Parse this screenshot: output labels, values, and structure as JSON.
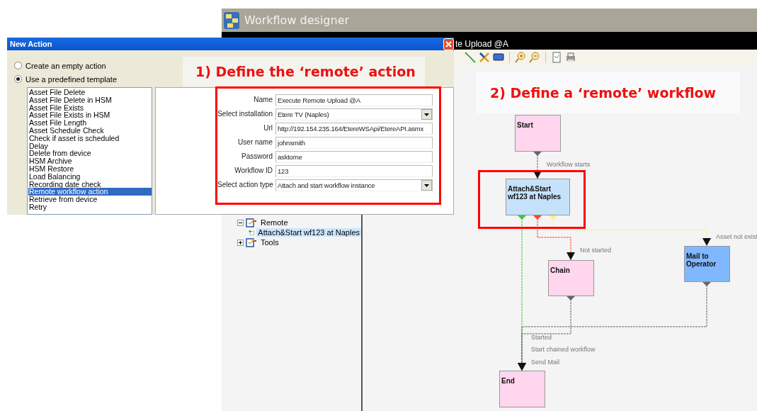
{
  "designer": {
    "title": "Workflow designer",
    "document_title": "te Upload @A",
    "tree": [
      {
        "label": "Remote",
        "expanded": true,
        "children": [
          {
            "label": "Attach&Start wf123 at Naples",
            "selected": true
          }
        ]
      },
      {
        "label": "Tools",
        "expanded": false
      }
    ],
    "diagram": {
      "nodes": [
        {
          "label": "Start",
          "color": "#ffd6ee"
        },
        {
          "label": "Attach&Start wf123 at Naples",
          "color": "#c6e2fb"
        },
        {
          "label": "Chain",
          "color": "#ffd6ee"
        },
        {
          "label": "Mail to Operator",
          "color": "#80b8ff"
        },
        {
          "label": "End",
          "color": "#ffd6ee"
        }
      ],
      "edges": [
        {
          "label": "Workflow starts",
          "color": "#666666"
        },
        {
          "label": "Started",
          "color": "#33cc33"
        },
        {
          "label": "Not started",
          "color": "#ff4422"
        },
        {
          "label": "Asset not exist",
          "color": "#ffee77"
        },
        {
          "label": "Start chained workflow",
          "color": "#666666"
        },
        {
          "label": "Send Mail",
          "color": "#666666"
        }
      ]
    }
  },
  "dialog": {
    "title": "New Action",
    "options": [
      {
        "label": "Create an empty action",
        "selected": false
      },
      {
        "label": "Use a predefined template",
        "selected": true
      }
    ],
    "templates": [
      {
        "label": "Asset File Delete",
        "selected": false
      },
      {
        "label": "Asset File Delete in HSM",
        "selected": false
      },
      {
        "label": "Asset File Exists",
        "selected": false
      },
      {
        "label": "Asset File Exists in HSM",
        "selected": false
      },
      {
        "label": "Asset File Length",
        "selected": false
      },
      {
        "label": "Asset Schedule Check",
        "selected": false
      },
      {
        "label": "Check if asset is scheduled",
        "selected": false
      },
      {
        "label": "Delay",
        "selected": false
      },
      {
        "label": "Delete from device",
        "selected": false
      },
      {
        "label": "HSM Archive",
        "selected": false
      },
      {
        "label": "HSM Restore",
        "selected": false
      },
      {
        "label": "Load Balancing",
        "selected": false
      },
      {
        "label": "Recording date check",
        "selected": false
      },
      {
        "label": "Remote workflow action",
        "selected": true
      },
      {
        "label": "Retrieve from device",
        "selected": false
      },
      {
        "label": "Retry",
        "selected": false
      }
    ],
    "form": [
      {
        "kind": "text",
        "label": "Name",
        "value": "Execute Remote Upload @A"
      },
      {
        "kind": "select",
        "label": "Select installation",
        "value": "Etere TV (Naples)"
      },
      {
        "kind": "text",
        "label": "Url",
        "value": "http://192.154.235.164/EtereWSApi/EtereAPI.asmx"
      },
      {
        "kind": "text",
        "label": "User name",
        "value": "johnsmith"
      },
      {
        "kind": "text",
        "label": "Password",
        "value": "asktome"
      },
      {
        "kind": "text",
        "label": "Workflow ID",
        "value": "123"
      },
      {
        "kind": "select",
        "label": "Select action type",
        "value": "Attach and start workflow instance"
      }
    ]
  },
  "annotations": [
    {
      "text": "1) Define the ‘remote’ action"
    },
    {
      "text": "2) Define a ‘remote’ workflow"
    }
  ]
}
